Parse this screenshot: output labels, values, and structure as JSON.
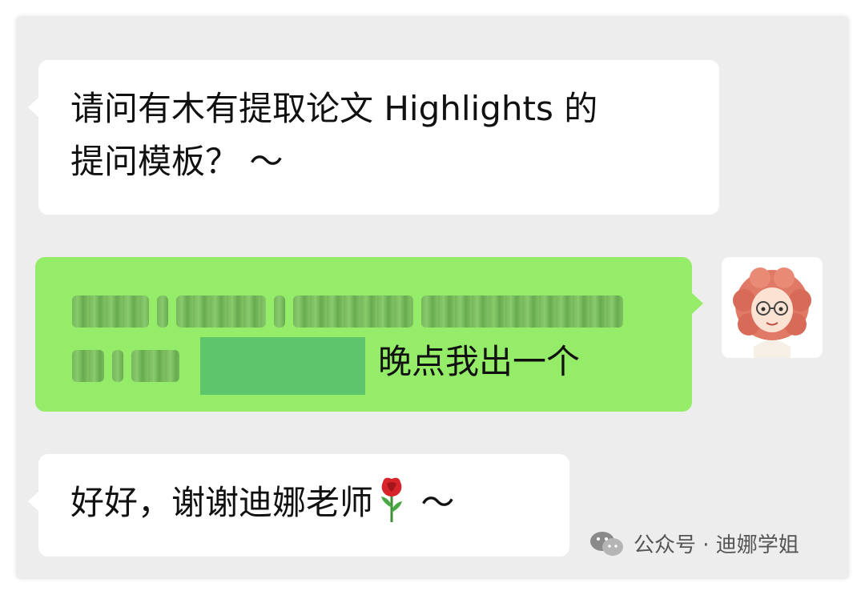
{
  "messages": {
    "msg1": {
      "line1": "请问有木有提取论文 Highlights 的",
      "line2": "提问模板？ ～"
    },
    "msg2": {
      "visible_text": "晚点我出一个"
    },
    "msg3": {
      "text": "好好，谢谢迪娜老师",
      "emoji_name": "rose-icon",
      "suffix": " ～"
    }
  },
  "watermark": {
    "icon": "wechat-icon",
    "text": "公众号 · 迪娜学姐"
  },
  "colors": {
    "chat_background": "#ededed",
    "incoming_bubble": "#ffffff",
    "outgoing_bubble": "#95ec69",
    "censor_block": "#5fc56a"
  }
}
